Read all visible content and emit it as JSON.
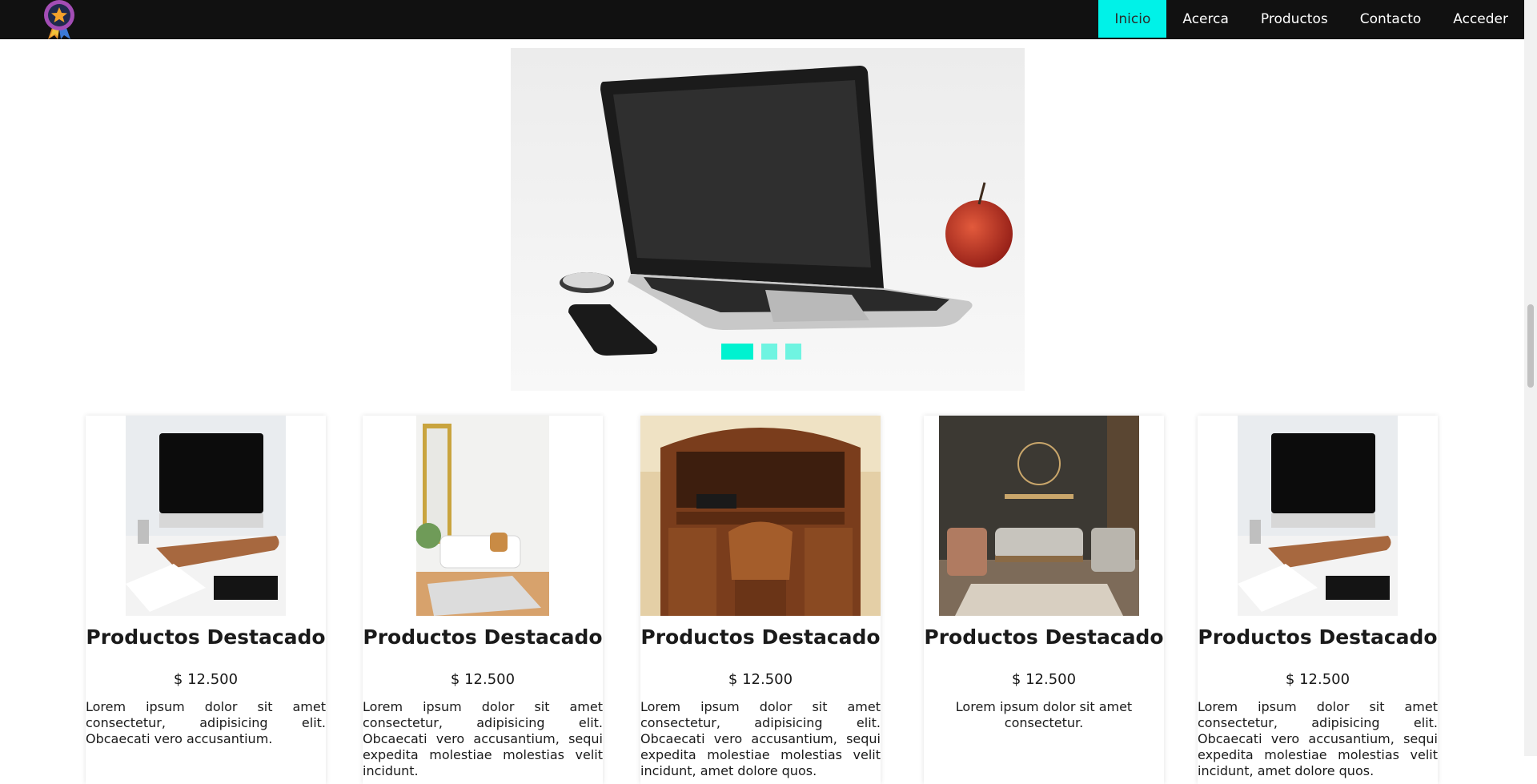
{
  "nav": {
    "items": [
      {
        "label": "Inicio",
        "active": true
      },
      {
        "label": "Acerca",
        "active": false
      },
      {
        "label": "Productos",
        "active": false
      },
      {
        "label": "Contacto",
        "active": false
      },
      {
        "label": "Acceder",
        "active": false
      }
    ]
  },
  "logo": {
    "icon": "star-medal-icon"
  },
  "hero": {
    "slide_count": 3,
    "active_slide": 1,
    "image": "laptop-apple-phone-photo"
  },
  "products": [
    {
      "title": "Productos Destacado",
      "price": "$ 12.500",
      "description": "Lorem ipsum dolor sit amet consectetur, adipisicing elit. Obcaecati vero accusantium.",
      "image": "imac-desk-photo"
    },
    {
      "title": "Productos Destacado",
      "price": "$ 12.500",
      "description": "Lorem ipsum dolor sit amet consectetur, adipisicing elit. Obcaecati vero accusantium, sequi expedita molestiae molestias velit incidunt.",
      "image": "living-room-mirror-photo"
    },
    {
      "title": "Productos Destacado",
      "price": "$ 12.500",
      "description": "Lorem ipsum dolor sit amet consectetur, adipisicing elit. Obcaecati vero accusantium, sequi expedita molestiae molestias velit incidunt, amet dolore quos.",
      "image": "rolltop-desk-photo"
    },
    {
      "title": "Productos Destacado",
      "price": "$ 12.500",
      "description": "Lorem ipsum dolor sit amet consectetur.",
      "image": "sofa-showroom-photo"
    },
    {
      "title": "Productos Destacado",
      "price": "$ 12.500",
      "description": "Lorem ipsum dolor sit amet consectetur, adipisicing elit. Obcaecati vero accusantium, sequi expedita molestiae molestias velit incidunt, amet dolore quos.",
      "image": "imac-desk-photo"
    }
  ],
  "colors": {
    "accent": "#00f2e8",
    "nav_bg": "#111111"
  }
}
